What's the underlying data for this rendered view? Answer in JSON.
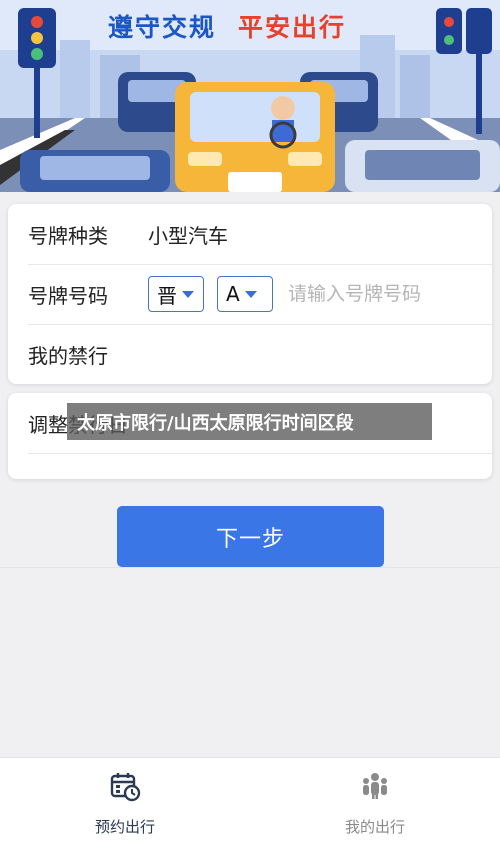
{
  "banner": {
    "title_left": "遵守交规",
    "title_right": "平安出行",
    "colors": {
      "left": "#1a56c4",
      "right": "#e8402a"
    }
  },
  "form": {
    "plate_type_label": "号牌种类",
    "plate_type_value": "小型汽车",
    "plate_number_label": "号牌号码",
    "province_value": "晋",
    "letter_value": "A",
    "plate_placeholder": "请输入号牌号码",
    "my_restriction_label": "我的禁行",
    "adjust_label": "调整禁行日"
  },
  "watermark": "太原市限行/山西太原限行时间区段",
  "next_button": "下一步",
  "tabbar": {
    "tabs": [
      {
        "label": "预约出行",
        "icon": "calendar-clock-icon",
        "active": true
      },
      {
        "label": "我的出行",
        "icon": "people-icon",
        "active": false
      }
    ]
  },
  "accent_color": "#3b76e6"
}
